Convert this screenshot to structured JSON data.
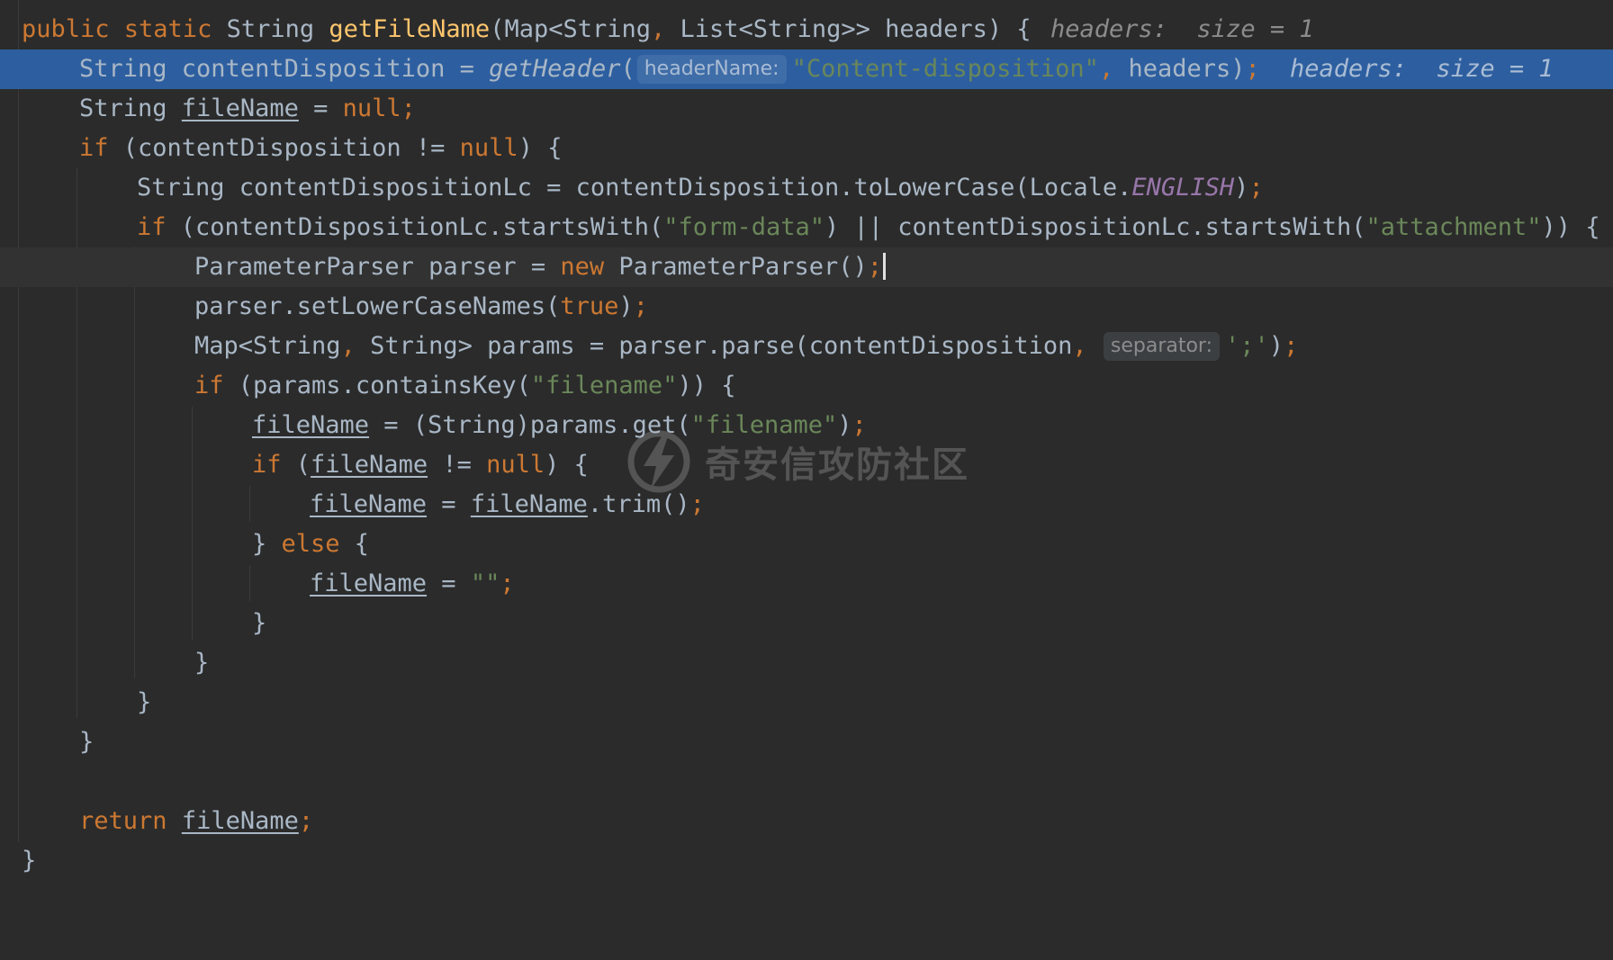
{
  "watermark_text": "奇安信攻防社区",
  "colors": {
    "background": "#2b2b2b",
    "debug_highlight": "#2d5fa0",
    "keyword": "#cc7832",
    "method": "#ffc66d",
    "string": "#6a8759",
    "constant": "#9876aa",
    "text": "#a9b7c6"
  },
  "code": {
    "l1": {
      "t1": "public static",
      "t2": " String ",
      "t3": "getFileName",
      "t4": "(Map<String",
      "t5": ",",
      "t6": " List<String>> headers) {",
      "dbg": "headers:  size = 1"
    },
    "l2": {
      "t1": "String contentDisposition = ",
      "t2": "getHeader",
      "t3": "(",
      "hint": "headerName:",
      "t4": "\"Content-disposition\"",
      "t5": ",",
      "t6": " headers)",
      "t7": ";",
      "dbg": "headers:  size = 1"
    },
    "l3": {
      "t1": "String ",
      "t2": "fileName",
      "t3": " = ",
      "t4": "null;"
    },
    "l4": {
      "t1": "if",
      "t2": " (contentDisposition != ",
      "t3": "null",
      "t4": ") {"
    },
    "l5": {
      "t1": "String contentDispositionLc = contentDisposition.toLowerCase(Locale.",
      "t2": "ENGLISH",
      "t3": ")",
      "t4": ";"
    },
    "l6": {
      "t1": "if",
      "t2": " (contentDispositionLc.startsWith(",
      "t3": "\"form-data\"",
      "t4": ") || contentDispositionLc.startsWith(",
      "t5": "\"attachment\"",
      "t6": ")) {"
    },
    "l7": {
      "t1": "ParameterParser parser = ",
      "t2": "new",
      "t3": " ParameterParser()",
      "t4": ";"
    },
    "l8": {
      "t1": "parser.setLowerCaseNames(",
      "t2": "true",
      "t3": ")",
      "t4": ";"
    },
    "l9": {
      "t1": "Map<String",
      "t2": ",",
      "t3": " String> params = parser.parse(contentDisposition",
      "t4": ",",
      "hint": "separator:",
      "t5": "';'",
      "t6": ")",
      "t7": ";"
    },
    "l10": {
      "t1": "if",
      "t2": " (params.containsKey(",
      "t3": "\"filename\"",
      "t4": ")) {"
    },
    "l11": {
      "t1": "fileName",
      "t2": " = (String)params.get(",
      "t3": "\"filename\"",
      "t4": ")",
      "t5": ";"
    },
    "l12": {
      "t1": "if",
      "t2": " (",
      "t3": "fileName",
      "t4": " != ",
      "t5": "null",
      "t6": ") {"
    },
    "l13": {
      "t1": "fileName",
      "t2": " = ",
      "t3": "fileName",
      "t4": ".trim()",
      "t5": ";"
    },
    "l14": {
      "t1": "} ",
      "t2": "else",
      "t3": " {"
    },
    "l15": {
      "t1": "fileName",
      "t2": " = ",
      "t3": "\"\"",
      "t4": ";"
    },
    "l16": {
      "t1": "}"
    },
    "l17": {
      "t1": "}"
    },
    "l18": {
      "t1": "}"
    },
    "l19": {
      "t1": "}"
    },
    "l20": {
      "t1": "return",
      "t2": " ",
      "t3": "fileName",
      "t4": ";"
    },
    "l21": {
      "t1": "}"
    }
  }
}
